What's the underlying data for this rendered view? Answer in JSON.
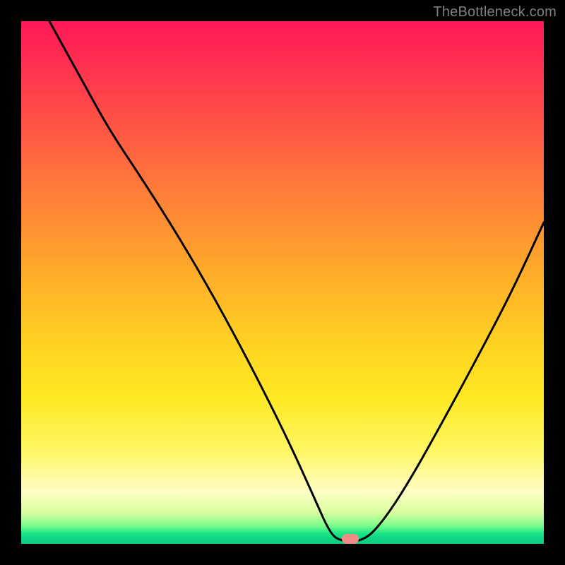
{
  "watermark": "TheBottleneck.com",
  "marker": {
    "x_pct": 0.63,
    "y_pct": 0.99
  },
  "chart_data": {
    "type": "line",
    "title": "",
    "xlabel": "",
    "ylabel": "",
    "xlim": [
      0.0,
      1.0
    ],
    "ylim": [
      0.0,
      1.0
    ],
    "series": [
      {
        "name": "curve",
        "points": [
          {
            "x": 0.054,
            "y": 1.0
          },
          {
            "x": 0.12,
            "y": 0.88
          },
          {
            "x": 0.17,
            "y": 0.79
          },
          {
            "x": 0.23,
            "y": 0.7
          },
          {
            "x": 0.3,
            "y": 0.59
          },
          {
            "x": 0.37,
            "y": 0.47
          },
          {
            "x": 0.44,
            "y": 0.34
          },
          {
            "x": 0.51,
            "y": 0.2
          },
          {
            "x": 0.56,
            "y": 0.09
          },
          {
            "x": 0.59,
            "y": 0.022
          },
          {
            "x": 0.61,
            "y": 0.005
          },
          {
            "x": 0.655,
            "y": 0.005
          },
          {
            "x": 0.69,
            "y": 0.04
          },
          {
            "x": 0.74,
            "y": 0.115
          },
          {
            "x": 0.81,
            "y": 0.24
          },
          {
            "x": 0.88,
            "y": 0.37
          },
          {
            "x": 0.94,
            "y": 0.485
          },
          {
            "x": 1.0,
            "y": 0.615
          }
        ]
      }
    ],
    "gradient_stops": [
      {
        "pos": 0.0,
        "color": "#ff1856"
      },
      {
        "pos": 0.5,
        "color": "#ffb128"
      },
      {
        "pos": 0.82,
        "color": "#fff663"
      },
      {
        "pos": 0.96,
        "color": "#7dfc8c"
      },
      {
        "pos": 1.0,
        "color": "#0fcd82"
      }
    ]
  }
}
